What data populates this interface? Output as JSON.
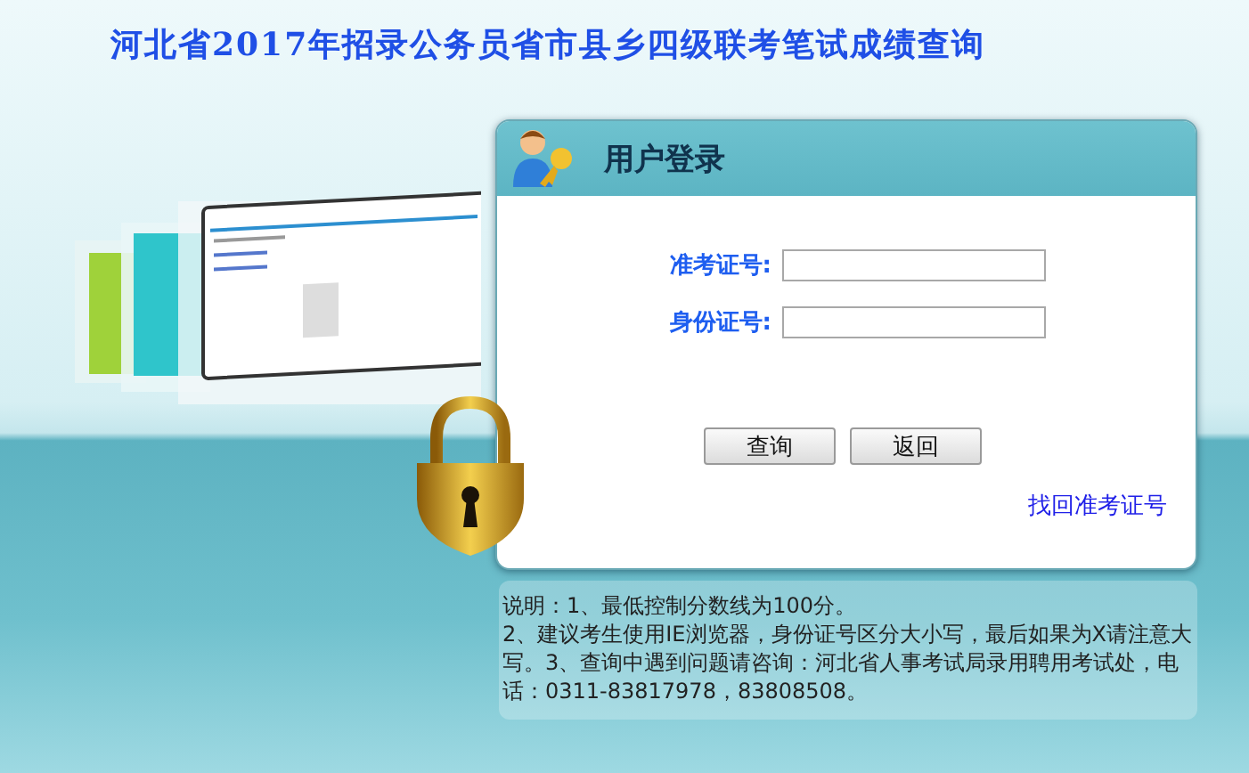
{
  "page_title": "河北省2017年招录公务员省市县乡四级联考笔试成绩查询",
  "login": {
    "title": "用户登录",
    "fields": [
      {
        "label": "准考证号:"
      },
      {
        "label": "身份证号:"
      }
    ],
    "buttons": [
      "查询",
      "返回"
    ],
    "link": "找回准考证号"
  },
  "notes": [
    "说明：1、最低控制分数线为100分。",
    "2、建议考生使用IE浏览器，身份证号区分大小写，最后如果为X请注意大写。3、查询中遇到问题请咨询：河北省人事考试局录用聘用考试处，电话：0311-83817978，83808508。"
  ]
}
